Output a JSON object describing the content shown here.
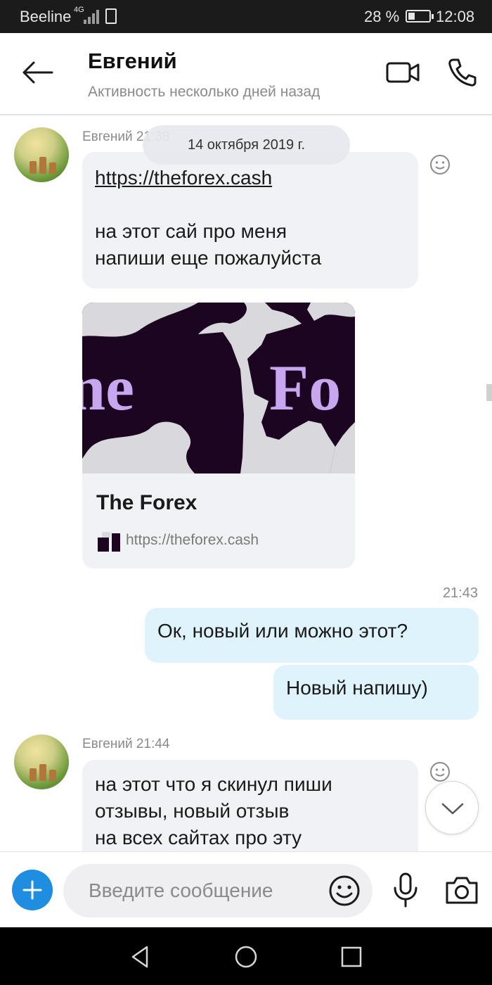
{
  "status_bar": {
    "carrier": "Beeline",
    "network": "4G",
    "battery_percent": "28 %",
    "battery_level": 0.28,
    "time": "12:08"
  },
  "header": {
    "contact_name": "Евгений",
    "presence": "Активность несколько дней назад"
  },
  "chat": {
    "date_separator": "14 октября 2019 г.",
    "messages": [
      {
        "direction": "incoming",
        "sender_line": "Евгений 21:38",
        "link": "https://theforex.cash",
        "lines": [
          "на этот сай про меня",
          "напиши еще пожалуйста"
        ]
      },
      {
        "direction": "outgoing",
        "time": "21:43",
        "text": "Ок, новый или можно этот?"
      },
      {
        "direction": "outgoing",
        "text": "Новый напишу)"
      },
      {
        "direction": "incoming",
        "sender_line": "Евгений 21:44",
        "lines": [
          "на этот что я скинул пиши",
          "отзывы, новый отзыв",
          "на всех сайтах про эту"
        ]
      }
    ],
    "link_preview": {
      "title": "The Forex",
      "url": "https://theforex.cash",
      "image_text": "ne Fo"
    }
  },
  "composer": {
    "placeholder": "Введите сообщение"
  },
  "colors": {
    "accent": "#1f8ee0",
    "incoming_bubble": "#f1f2f6",
    "outgoing_bubble": "#def3fc",
    "status_bar": "#1b1b1b",
    "preview_image_bg": "#1b0520",
    "preview_image_text": "#c9a6f0"
  },
  "icons": {
    "header": [
      "back-arrow-icon",
      "video-call-icon",
      "phone-icon"
    ],
    "composer": [
      "add-icon",
      "emoji-icon",
      "microphone-icon",
      "camera-icon"
    ],
    "navbar": [
      "nav-back-icon",
      "nav-home-icon",
      "nav-recents-icon"
    ]
  }
}
